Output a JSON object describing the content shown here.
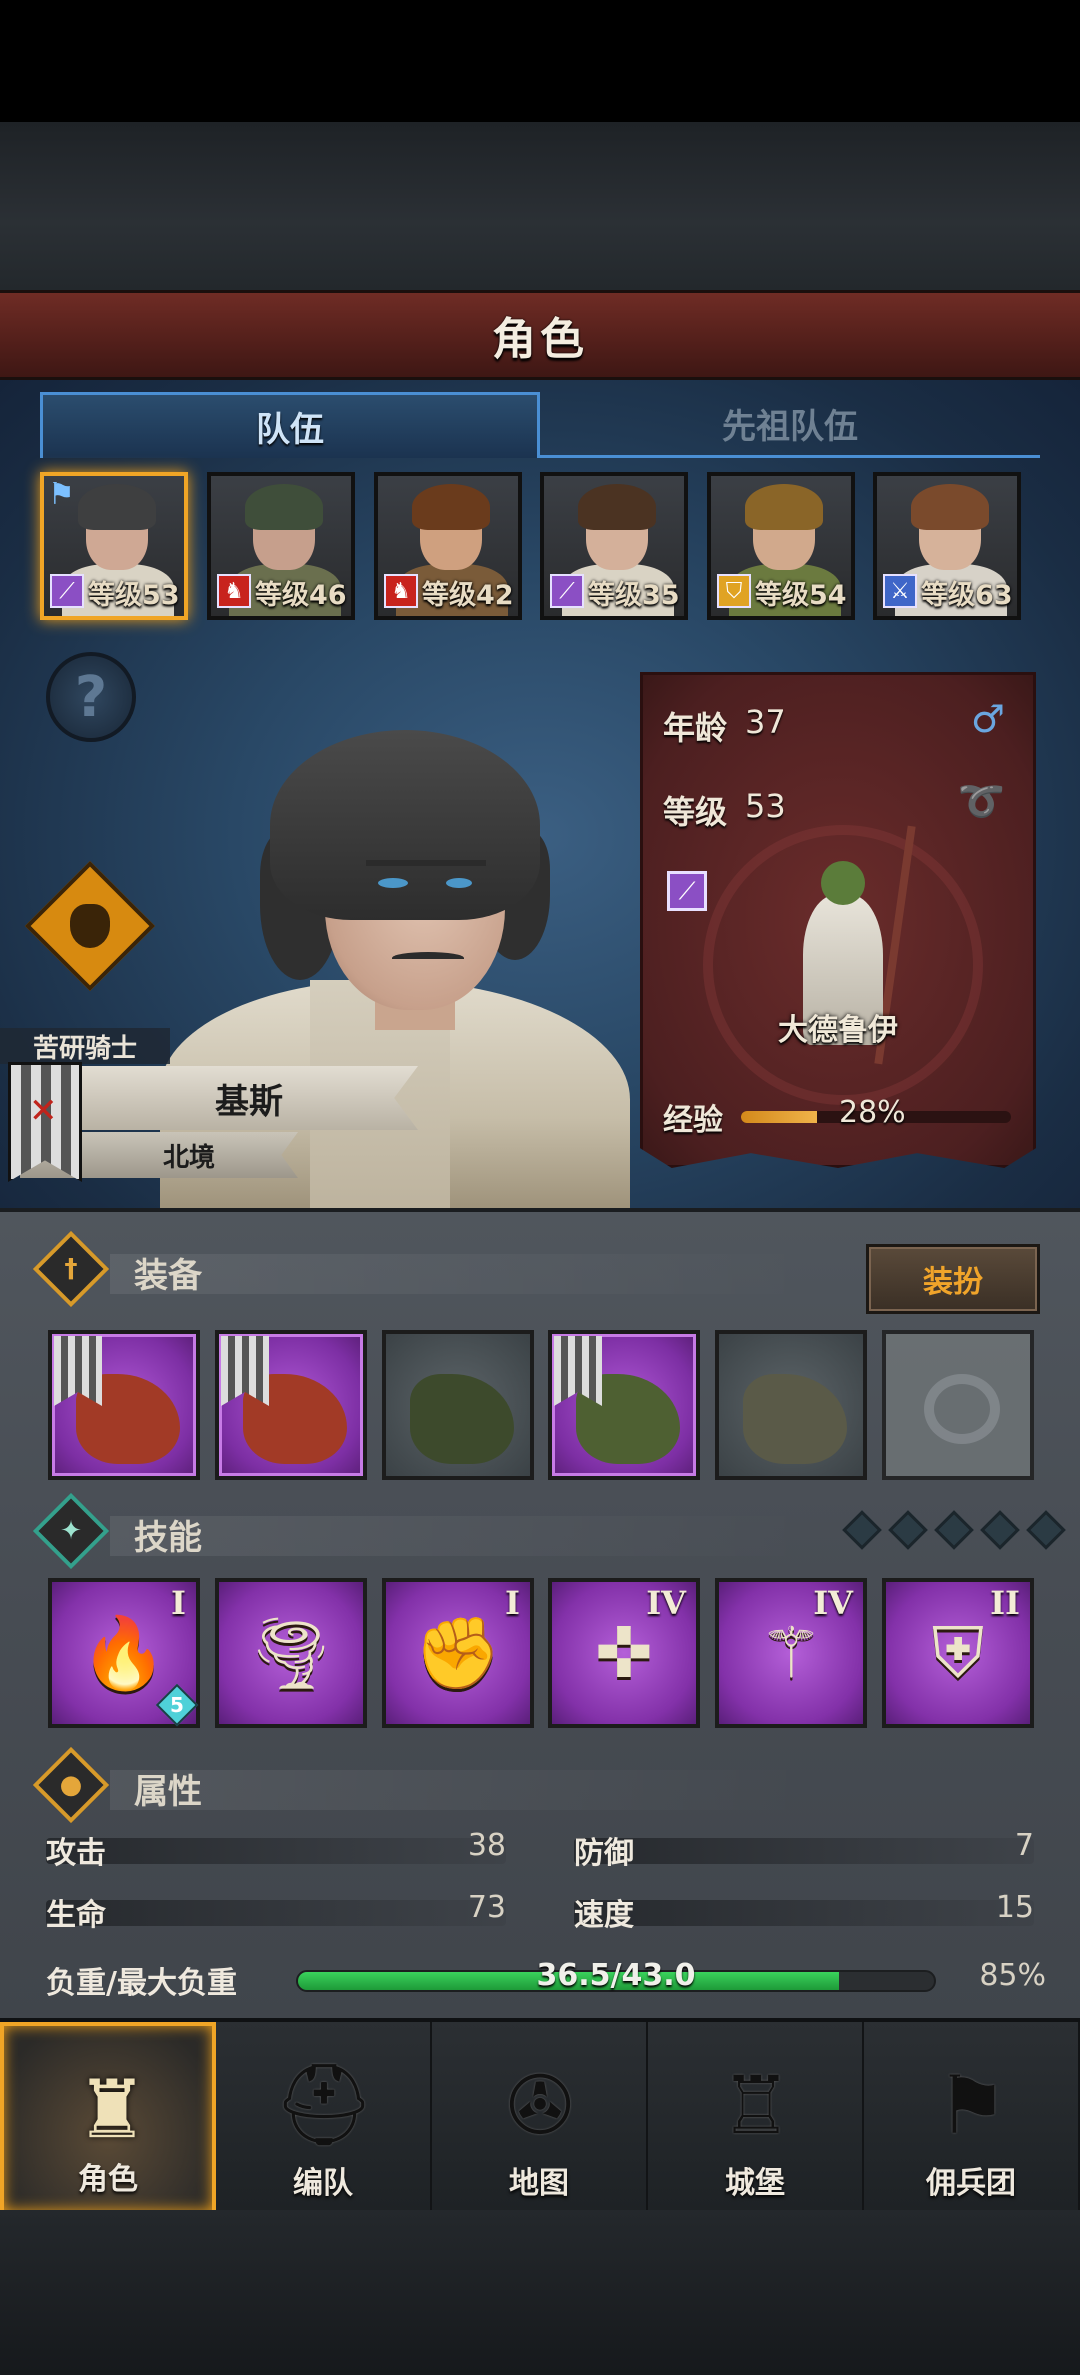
{
  "header": {
    "title": "角色"
  },
  "tabs": [
    {
      "label": "队伍",
      "active": true
    },
    {
      "label": "先祖队伍",
      "active": false
    }
  ],
  "roster": [
    {
      "level_text": "等级53",
      "class_color": "#8b4fc4",
      "class_icon": "staff",
      "hair": "#3e3f40",
      "body": "#d9d3c4",
      "skin": "#cfa894",
      "selected": true,
      "flag": true
    },
    {
      "level_text": "等级46",
      "class_color": "#c8231d",
      "class_icon": "horse",
      "hair": "#3f4e3a",
      "body": "#6a6f4e",
      "skin": "#c69f8c",
      "selected": false,
      "flag": false
    },
    {
      "level_text": "等级42",
      "class_color": "#c8231d",
      "class_icon": "horse",
      "hair": "#6a3b1c",
      "body": "#7a5b39",
      "skin": "#cfa07f",
      "selected": false,
      "flag": false
    },
    {
      "level_text": "等级35",
      "class_color": "#8b4fc4",
      "class_icon": "staff",
      "hair": "#4b3322",
      "body": "#d9d3c4",
      "skin": "#d4b09a",
      "selected": false,
      "flag": false
    },
    {
      "level_text": "等级54",
      "class_color": "#e0a323",
      "class_icon": "shield",
      "hair": "#8a6528",
      "body": "#6b7a3f",
      "skin": "#d1a98c",
      "selected": false,
      "flag": false
    },
    {
      "level_text": "等级63",
      "class_color": "#3f66c8",
      "class_icon": "sword",
      "hair": "#7a4a2c",
      "body": "#d7d2c8",
      "skin": "#d6b29a",
      "selected": false,
      "flag": false
    }
  ],
  "character": {
    "title": "苦研骑士",
    "name": "基斯",
    "origin": "北境",
    "age_label": "年龄",
    "age": "37",
    "level_label": "等级",
    "level": "53",
    "class_name": "大德鲁伊",
    "exp_label": "经验",
    "exp_percent": "28%",
    "exp_fraction": 0.28,
    "gender_icon": "♂",
    "trait_icon": "ring-icon"
  },
  "equipment": {
    "label": "装备",
    "dress_label": "装扮",
    "slots": [
      {
        "rarity": "epic",
        "item_color": "#a23a26",
        "banner": true,
        "icon": "gauntlet-icon"
      },
      {
        "rarity": "epic",
        "item_color": "#a23a26",
        "banner": true,
        "icon": "gauntlet-icon"
      },
      {
        "rarity": "common",
        "item_color": "#3d4a2c",
        "banner": false,
        "icon": "hood-icon"
      },
      {
        "rarity": "epic",
        "item_color": "#4e6032",
        "banner": true,
        "icon": "coat-icon"
      },
      {
        "rarity": "common",
        "item_color": "#5a5a48",
        "banner": false,
        "icon": "boots-icon"
      },
      {
        "rarity": "empty",
        "item_color": "",
        "banner": false,
        "icon": "ring-slot-icon"
      }
    ]
  },
  "skills": {
    "label": "技能",
    "points_total": 5,
    "items": [
      {
        "glyph": "🔥",
        "roman": "I",
        "gem": "5",
        "icon": "fire-hand-icon"
      },
      {
        "glyph": "🌪",
        "roman": "",
        "gem": "",
        "icon": "tornado-icon"
      },
      {
        "glyph": "✊",
        "roman": "I",
        "gem": "",
        "icon": "crystal-arm-icon"
      },
      {
        "glyph": "✜",
        "roman": "IV",
        "gem": "",
        "icon": "cross-target-icon"
      },
      {
        "glyph": "⚚",
        "roman": "IV",
        "gem": "",
        "icon": "staff-icon"
      },
      {
        "glyph": "⛨",
        "roman": "II",
        "gem": "",
        "icon": "shield-icon"
      }
    ]
  },
  "attributes": {
    "label": "属性",
    "attack_label": "攻击",
    "attack": "38",
    "defense_label": "防御",
    "defense": "7",
    "hp_label": "生命",
    "hp": "73",
    "speed_label": "速度",
    "speed": "15",
    "load_label": "负重/最大负重",
    "load_value": "36.5/43.0",
    "load_percent": "85%",
    "load_fraction": 0.85
  },
  "nav": [
    {
      "label": "角色",
      "icon": "knight-icon",
      "active": true
    },
    {
      "label": "编队",
      "icon": "helmet-icon",
      "active": false
    },
    {
      "label": "地图",
      "icon": "compass-icon",
      "active": false
    },
    {
      "label": "城堡",
      "icon": "castle-icon",
      "active": false
    },
    {
      "label": "佣兵团",
      "icon": "banner-icon",
      "active": false
    }
  ]
}
